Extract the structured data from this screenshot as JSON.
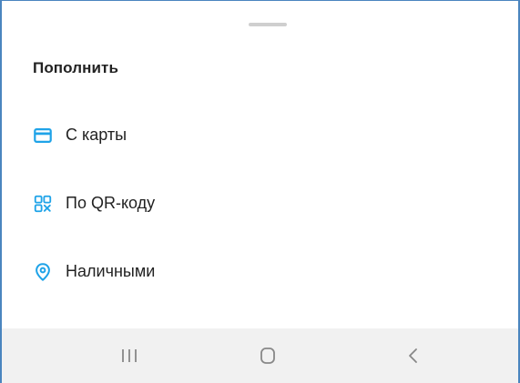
{
  "sheet": {
    "title": "Пополнить",
    "items": [
      {
        "label": "С карты",
        "icon": "card-icon"
      },
      {
        "label": "По QR-коду",
        "icon": "qr-code-icon"
      },
      {
        "label": "Наличными",
        "icon": "location-pin-icon"
      }
    ]
  },
  "navbar": {
    "buttons": [
      {
        "icon": "recent-apps-icon"
      },
      {
        "icon": "home-icon"
      },
      {
        "icon": "back-icon"
      }
    ]
  },
  "colors": {
    "accent": "#1fa3e8",
    "text": "#222222",
    "navbar_bg": "#f1f1f1",
    "nav_icon": "#888888"
  }
}
